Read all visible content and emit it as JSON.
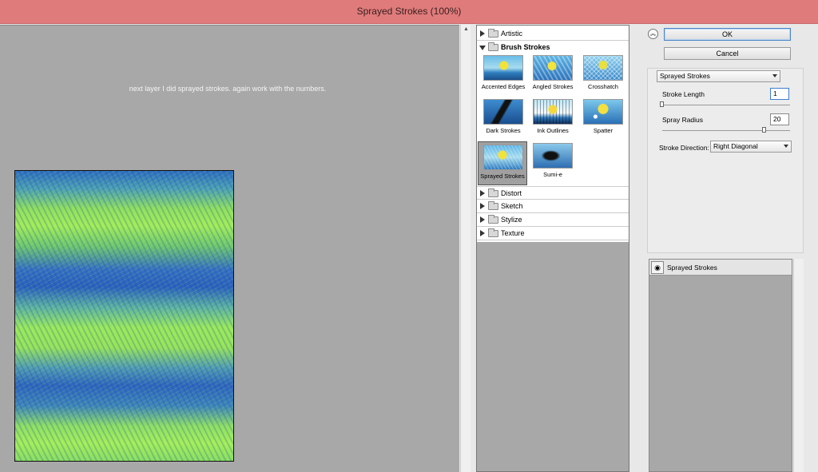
{
  "window": {
    "title": "Sprayed Strokes (100%)"
  },
  "preview": {
    "note": "next layer I did sprayed strokes. again work with the numbers."
  },
  "categories": {
    "artistic": "Artistic",
    "brush_strokes": "Brush Strokes",
    "distort": "Distort",
    "sketch": "Sketch",
    "stylize": "Stylize",
    "texture": "Texture"
  },
  "filters": [
    {
      "name": "Accented Edges"
    },
    {
      "name": "Angled Strokes"
    },
    {
      "name": "Crosshatch"
    },
    {
      "name": "Dark Strokes"
    },
    {
      "name": "Ink Outlines"
    },
    {
      "name": "Spatter"
    },
    {
      "name": "Sprayed Strokes",
      "selected": true
    },
    {
      "name": "Sumi-e"
    }
  ],
  "buttons": {
    "ok": "OK",
    "cancel": "Cancel"
  },
  "settings": {
    "filter_select": "Sprayed Strokes",
    "stroke_length": {
      "label": "Stroke Length",
      "value": "1",
      "slider_fraction": 0.0
    },
    "spray_radius": {
      "label": "Spray Radius",
      "value": "20",
      "slider_fraction": 0.8
    },
    "stroke_direction": {
      "label": "Stroke Direction:",
      "value": "Right Diagonal"
    }
  },
  "layers": [
    {
      "name": "Sprayed Strokes"
    }
  ],
  "icons": {
    "collapse": "double-chevron-up-icon",
    "visibility": "eye-icon",
    "folder": "folder-icon"
  }
}
